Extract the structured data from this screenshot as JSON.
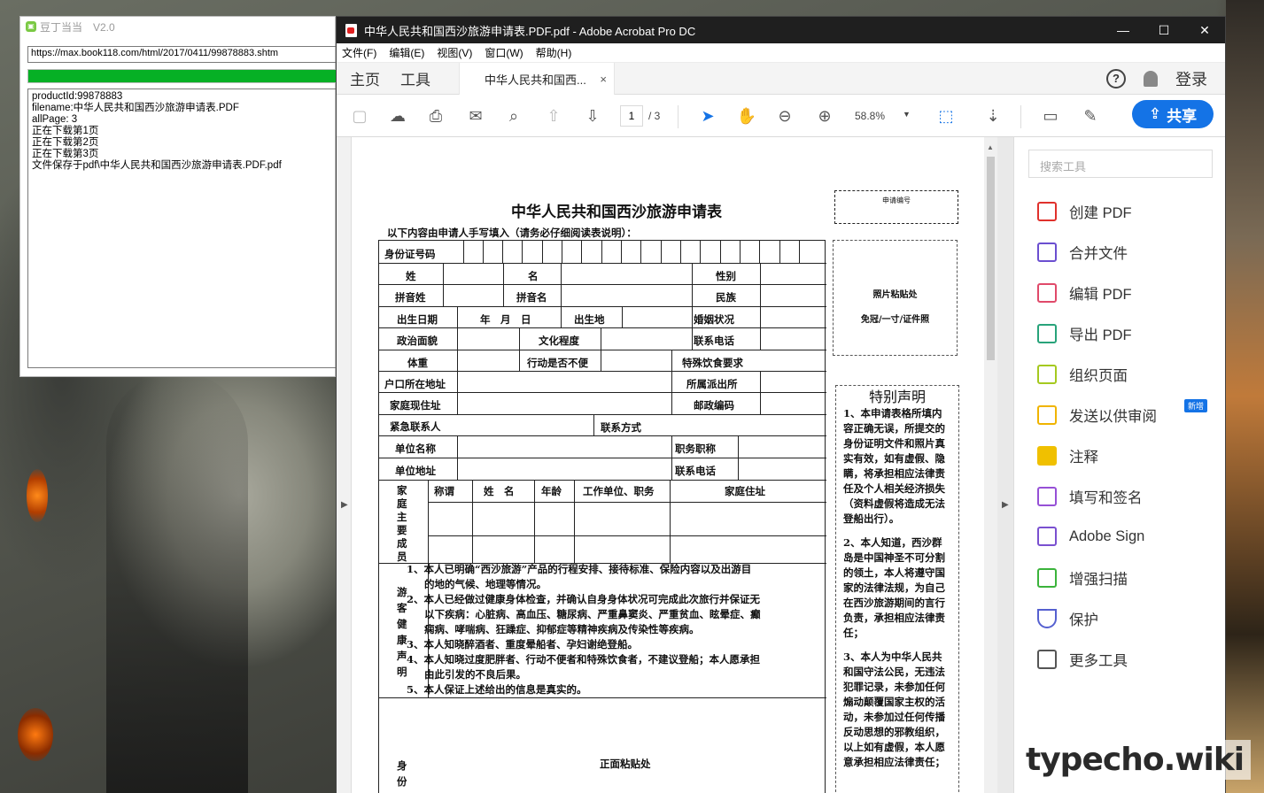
{
  "downloader": {
    "title": "豆丁当当　V2.0",
    "url": "https://max.book118.com/html/2017/0411/99878883.shtm",
    "progress": 1.0,
    "log": [
      "productId:99878883",
      "filename:中华人民共和国西沙旅游申请表.PDF",
      "allPage: 3",
      "正在下载第1页",
      "正在下载第2页",
      "正在下载第3页",
      "文件保存于pdf\\中华人民共和国西沙旅游申请表.PDF.pdf"
    ]
  },
  "acrobat": {
    "title": "中华人民共和国西沙旅游申请表.PDF.pdf - Adobe Acrobat Pro DC",
    "menu": [
      "文件(F)",
      "编辑(E)",
      "视图(V)",
      "窗口(W)",
      "帮助(H)"
    ],
    "tabs": {
      "home": "主页",
      "tools": "工具",
      "doc": "中华人民共和国西...",
      "close": "×"
    },
    "help": "?",
    "login": "登录",
    "page_current": "1",
    "page_total": "/ 3",
    "zoom": "58.8%",
    "share": "共享",
    "tools_search_placeholder": "搜索工具",
    "tools": [
      {
        "label": "创建 PDF",
        "color": "#e0312c"
      },
      {
        "label": "合并文件",
        "color": "#6b4fd0"
      },
      {
        "label": "编辑 PDF",
        "color": "#e04a6a"
      },
      {
        "label": "导出 PDF",
        "color": "#28a37a"
      },
      {
        "label": "组织页面",
        "color": "#a5c91f"
      },
      {
        "label": "发送以供审阅",
        "color": "#f0b400"
      },
      {
        "label": "注释",
        "color": "#f0c000"
      },
      {
        "label": "填写和签名",
        "color": "#9650d6"
      },
      {
        "label": "Adobe Sign",
        "color": "#7a50d0"
      },
      {
        "label": "增强扫描",
        "color": "#3bb33b"
      },
      {
        "label": "保护",
        "color": "#5560d0"
      },
      {
        "label": "更多工具",
        "color": "#555555"
      }
    ],
    "new_badge": "新增"
  },
  "pdf": {
    "title": "中华人民共和国西沙旅游申请表",
    "note": "以下内容由申请人手写填入（请务必仔细阅读表说明）：",
    "app_no": "申请编号",
    "photo_line1": "照片粘贴处",
    "photo_line2": "免冠/一寸/证件照",
    "fields": {
      "id": "身份证号码",
      "surname": "姓",
      "given": "名",
      "gender": "性别",
      "py_surname": "拼音姓",
      "py_given": "拼音名",
      "ethnic": "民族",
      "dob": "出生日期",
      "ymd": "年　月　日",
      "birthplace": "出生地",
      "marital": "婚姻状况",
      "political": "政治面貌",
      "education": "文化程度",
      "phone": "联系电话",
      "weight": "体重",
      "mobility": "行动是否不便",
      "diet": "特殊饮食要求",
      "hukou": "户口所在地址",
      "police": "所属派出所",
      "home": "家庭现住址",
      "zip": "邮政编码",
      "emergency": "紧急联系人",
      "contact": "联系方式",
      "employer": "单位名称",
      "position": "职务职称",
      "employer_addr": "单位地址",
      "phone2": "联系电话",
      "family": "家庭主要成员",
      "relation": "称谓",
      "name": "姓　名",
      "age": "年龄",
      "work": "工作单位、职务",
      "address": "家庭住址",
      "health": "游客健康声明",
      "idcard_side": "身份",
      "idcard_front": "正面粘贴处"
    },
    "terms": [
      "1、本人已明确“西沙旅游”产品的行程安排、接待标准、保险内容以及出游目",
      "的地的气候、地理等情况。",
      "2、本人已经做过健康身体检查，并确认自身身体状况可完成此次旅行并保证无",
      "以下疾病：心脏病、高血压、糖尿病、严重鼻窦炎、严重贫血、眩晕症、癫",
      "痫病、哮喘病、狂躁症、抑郁症等精神疾病及传染性等疾病。",
      "3、本人知晓醉酒者、重度晕船者、孕妇谢绝登船。",
      "4、本人知晓过度肥胖者、行动不便者和特殊饮食者，不建议登船；本人愿承担",
      "由此引发的不良后果。",
      "5、本人保证上述给出的信息是真实的。"
    ],
    "declaration": {
      "heading": "特别声明",
      "p1": "1、本申请表格所填内容正确无误，所提交的身份证明文件和照片真实有效，如有虚假、隐瞒，将承担相应法律责任及个人相关经济损失（资料虚假将造成无法登船出行）。",
      "p2": "2、本人知道，西沙群岛是中国神圣不可分割的领土，本人将遵守国家的法律法规，为自己在西沙旅游期间的言行负责，承担相应法律责任；",
      "p3": "3、本人为中华人民共和国守法公民，无违法犯罪记录，未参加任何煽动颠覆国家主权的活动，未参加过任何传播反动思想的邪教组织，以上如有虚假，本人愿意承担相应法律责任；"
    }
  },
  "watermark": "typecho.wiki"
}
